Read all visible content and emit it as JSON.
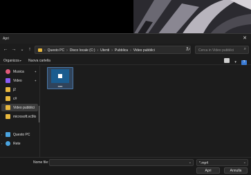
{
  "dialog": {
    "title": "Apri",
    "close_glyph": "✕"
  },
  "nav": {
    "back_glyph": "←",
    "forward_glyph": "→",
    "down_glyph": "⌄",
    "up_glyph": "↑",
    "refresh_glyph": "↻"
  },
  "address": {
    "crumbs": [
      "Questo PC",
      "Disco locale (C:)",
      "Utenti",
      "Pubblica",
      "Video pubblici"
    ],
    "separator": "›",
    "dropdown_glyph": "⌄"
  },
  "search": {
    "placeholder": "Cerca in Video pubblici",
    "icon": "search-icon",
    "glyph": "⌕"
  },
  "commands": {
    "organize": "Organizza",
    "new_folder": "Nuova cartella",
    "chevron": "▾",
    "help_glyph": "?"
  },
  "sidebar": {
    "items": [
      {
        "label": "Musica",
        "icon": "music-icon",
        "color": "#e05a7a",
        "pinned": true
      },
      {
        "label": "Video",
        "icon": "video-icon",
        "color": "#8b5cf6",
        "pinned": true
      },
      {
        "label": "j2",
        "icon": "folder-icon",
        "color": "#e8b83e",
        "pinned": false
      },
      {
        "label": "c#",
        "icon": "folder-icon",
        "color": "#e8b83e",
        "pinned": false
      },
      {
        "label": "Video pubblici",
        "icon": "folder-icon",
        "color": "#e8b83e",
        "pinned": false,
        "selected": true
      },
      {
        "label": "microsoft.vc9lo",
        "icon": "folder-icon",
        "color": "#e8b83e",
        "pinned": false
      },
      {
        "label": "Questo PC",
        "icon": "pc-icon",
        "color": "#4aa3df",
        "pinned": false
      },
      {
        "label": "Rete",
        "icon": "network-icon",
        "color": "#4aa3df",
        "pinned": false
      }
    ],
    "pin_glyph": "✦",
    "expand_glyph": "›"
  },
  "files": [
    {
      "name": "aaa",
      "icon": "video-file-icon"
    }
  ],
  "bottom": {
    "filename_label": "Nome file:",
    "filename_value": "",
    "filter_value": "*.mp4",
    "dropdown_glyph": "⌄",
    "open_button": "Apri",
    "cancel_button": "Annulla"
  }
}
